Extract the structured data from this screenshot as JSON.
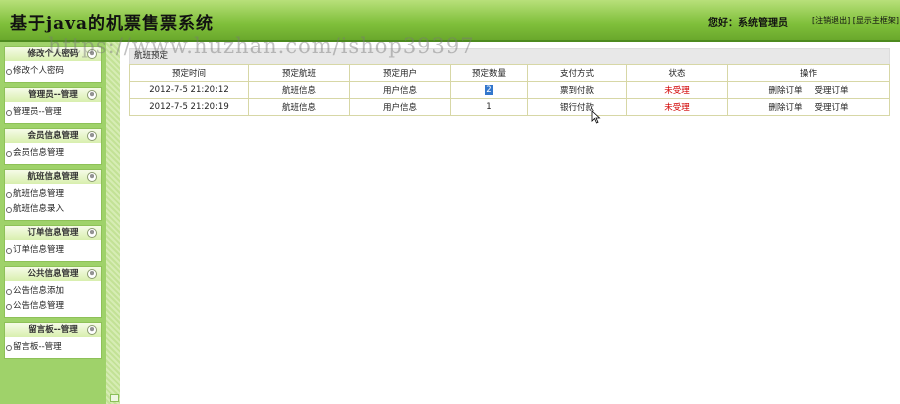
{
  "app": {
    "title": "基于java的机票售票系统",
    "greeting": "您好：系统管理员",
    "logout": "[注销退出]",
    "show_frame": "[显示主框架]"
  },
  "watermark": "https://www.huzhan.com/ishop39397",
  "sidebar": {
    "groups": [
      {
        "title": "修改个人密码",
        "items": [
          "修改个人密码"
        ]
      },
      {
        "title": "管理员--管理",
        "items": [
          "管理员--管理"
        ]
      },
      {
        "title": "会员信息管理",
        "items": [
          "会员信息管理"
        ]
      },
      {
        "title": "航班信息管理",
        "items": [
          "航班信息管理",
          "航班信息录入"
        ]
      },
      {
        "title": "订单信息管理",
        "items": [
          "订单信息管理"
        ]
      },
      {
        "title": "公共信息管理",
        "items": [
          "公告信息添加",
          "公告信息管理"
        ]
      },
      {
        "title": "留言板--管理",
        "items": [
          "留言板--管理"
        ]
      }
    ],
    "toggle_glyph": "⊗"
  },
  "main": {
    "caption": "航班预定",
    "columns": [
      "预定时间",
      "预定航班",
      "预定用户",
      "预定数量",
      "支付方式",
      "状态",
      "操作"
    ],
    "rows": [
      {
        "time": "2012-7-5 21:20:12",
        "flight": "航班信息",
        "user": "用户信息",
        "qty": "2",
        "pay": "票到付款",
        "status": "未受理",
        "op1": "删除订单",
        "op2": "受理订单"
      },
      {
        "time": "2012-7-5 21:20:19",
        "flight": "航班信息",
        "user": "用户信息",
        "qty": "1",
        "pay": "银行付款",
        "status": "未受理",
        "op1": "删除订单",
        "op2": "受理订单"
      }
    ]
  },
  "colors": {
    "header": "#7fbf3a",
    "sidebar": "#9fd26a",
    "status_red": "#d10000",
    "selection": "#3377cc"
  }
}
